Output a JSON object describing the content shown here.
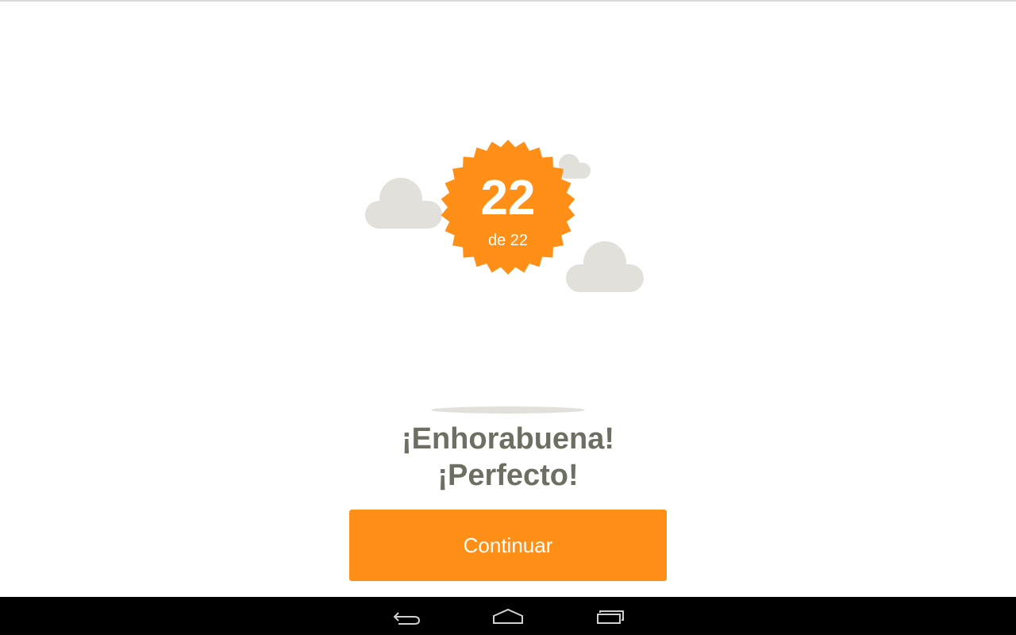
{
  "badge": {
    "number": "22",
    "subtext": "de 22",
    "color": "#ff8f17"
  },
  "message": {
    "line1": "¡Enhorabuena!",
    "line2": "¡Perfecto!",
    "color": "#6f6e63"
  },
  "continue_button": {
    "label": "Continuar",
    "color": "#ff8f17"
  },
  "clouds": {
    "color": "#e2e0da"
  },
  "navbar": {
    "buttons": [
      "back-icon",
      "home-icon",
      "recent-apps-icon"
    ]
  }
}
